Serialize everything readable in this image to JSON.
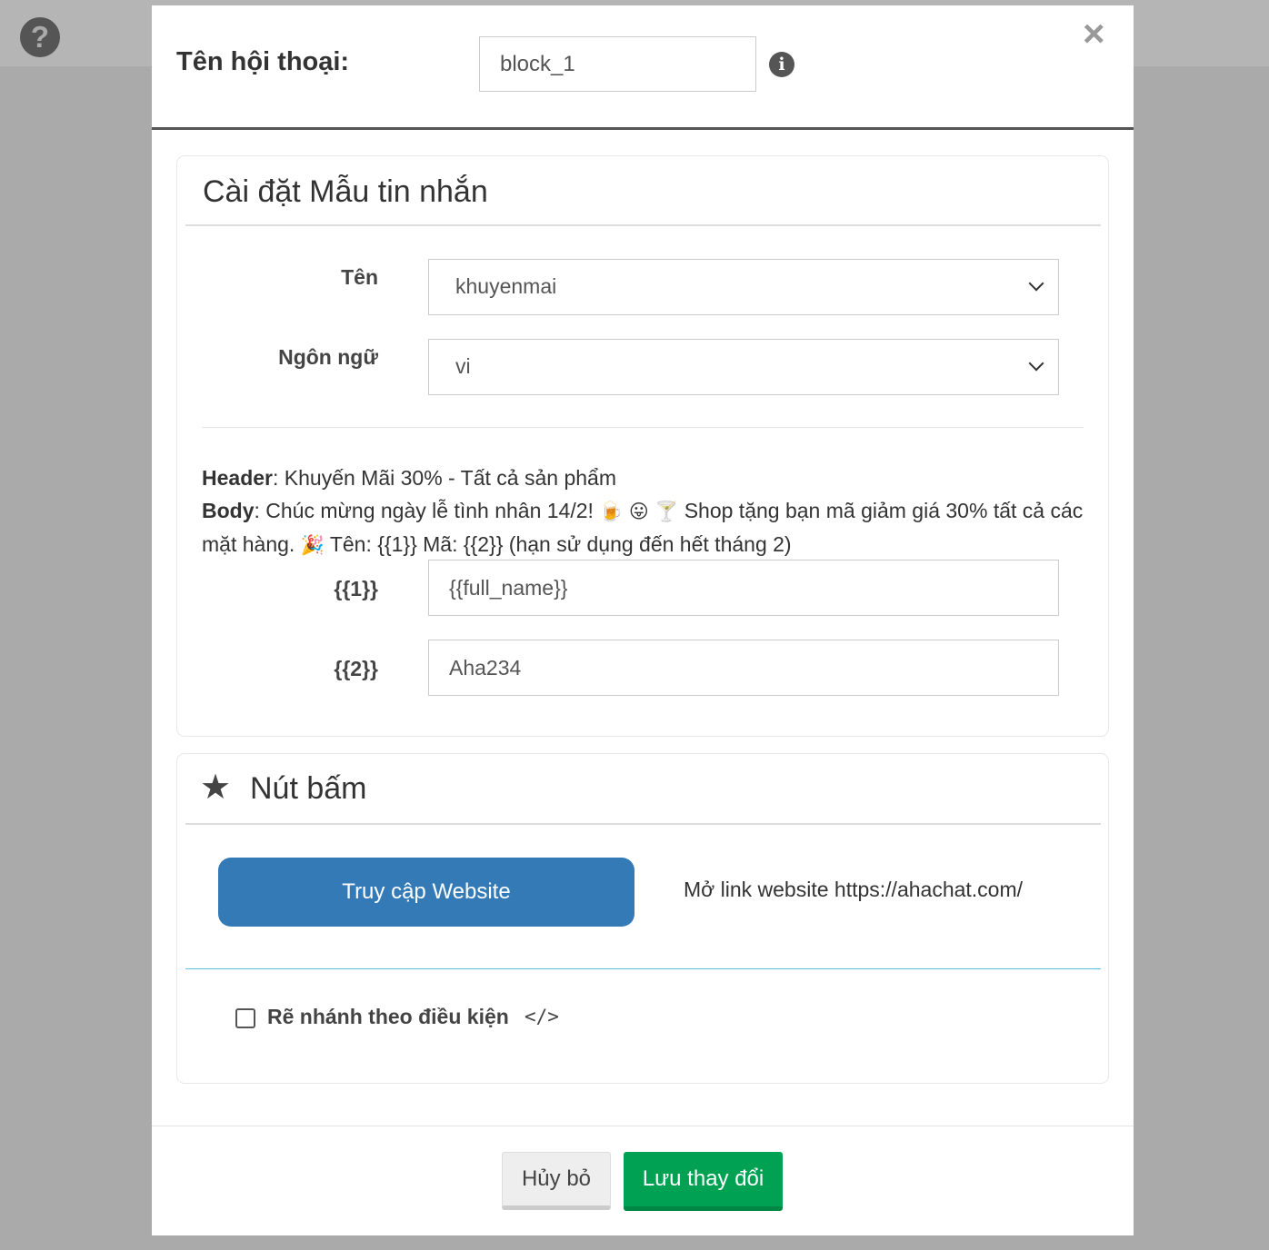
{
  "page": {
    "help_icon": "question-circle-icon"
  },
  "dialog": {
    "label": "Tên hội thoại:",
    "name_value": "block_1",
    "info_icon": "info-circle-icon",
    "close_icon": "times-icon"
  },
  "template_panel": {
    "title": "Cài đặt Mẫu tin nhắn",
    "name_label": "Tên",
    "name_value": "khuyenmai",
    "language_label": "Ngôn ngữ",
    "language_value": "vi",
    "preview": {
      "header_label": "Header",
      "header_text": ": Khuyến Mãi 30% - Tất cả sản phẩm",
      "body_label": "Body",
      "body_text_1": ": Chúc mừng ngày lễ tình nhân 14/2! ",
      "emoji_1": "🍺",
      "emoji_2": "😛",
      "emoji_3": "🍸",
      "body_text_2": " Shop tặng bạn mã giảm giá 30% tất cả các mặt hàng. ",
      "emoji_4": "🎉",
      "body_text_3": " Tên: {{1}} Mã: {{2}} (hạn sử dụng đến hết tháng 2)"
    },
    "variables": [
      {
        "label": "{{1}}",
        "value": "{{full_name}}"
      },
      {
        "label": "{{2}}",
        "value": "Aha234"
      }
    ]
  },
  "buttons_panel": {
    "title": "Nút bấm",
    "icon": "star-icon",
    "button_label": "Truy cập Website",
    "button_description": "Mở link website https://ahachat.com/",
    "branch_label": "Rẽ nhánh theo điều kiện",
    "code_icon": "</>"
  },
  "footer": {
    "cancel_label": "Hủy bỏ",
    "save_label": "Lưu thay đổi"
  },
  "colors": {
    "primary": "#337ab7",
    "success": "#00a152",
    "overlay": "#aaaaaa"
  }
}
